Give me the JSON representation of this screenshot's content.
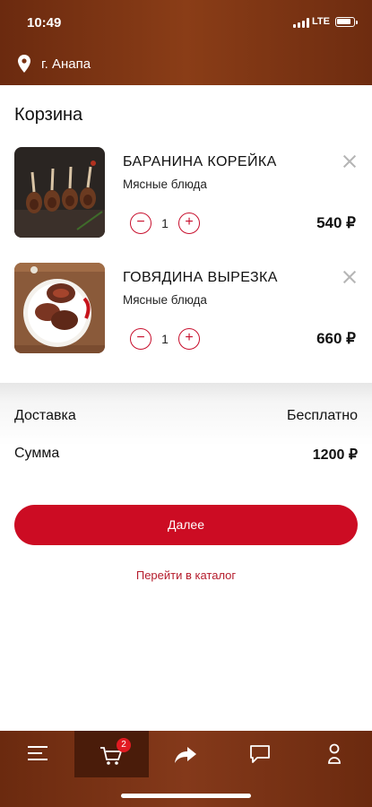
{
  "status_bar": {
    "time": "10:49",
    "network": "LTE"
  },
  "header": {
    "city": "г. Анапа"
  },
  "page": {
    "title": "Корзина"
  },
  "cart": {
    "items": [
      {
        "name": "БАРАНИНА КОРЕЙКА",
        "category": "Мясные блюда",
        "quantity": "1",
        "price": "540 ₽",
        "minus": "−",
        "plus": "+"
      },
      {
        "name": "ГОВЯДИНА ВЫРЕЗКА",
        "category": "Мясные блюда",
        "quantity": "1",
        "price": "660 ₽",
        "minus": "−",
        "plus": "+"
      }
    ]
  },
  "summary": {
    "delivery_label": "Доставка",
    "delivery_value": "Бесплатно",
    "total_label": "Сумма",
    "total_value": "1200 ₽"
  },
  "actions": {
    "next_label": "Далее",
    "catalog_label": "Перейти в каталог"
  },
  "bottom_nav": {
    "items": [
      {
        "icon": "menu-icon"
      },
      {
        "icon": "cart-icon",
        "badge": "2",
        "active": true
      },
      {
        "icon": "share-icon"
      },
      {
        "icon": "chat-icon"
      },
      {
        "icon": "profile-icon"
      }
    ]
  },
  "colors": {
    "accent": "#cc0c23",
    "header_bg": "#7a3213"
  }
}
